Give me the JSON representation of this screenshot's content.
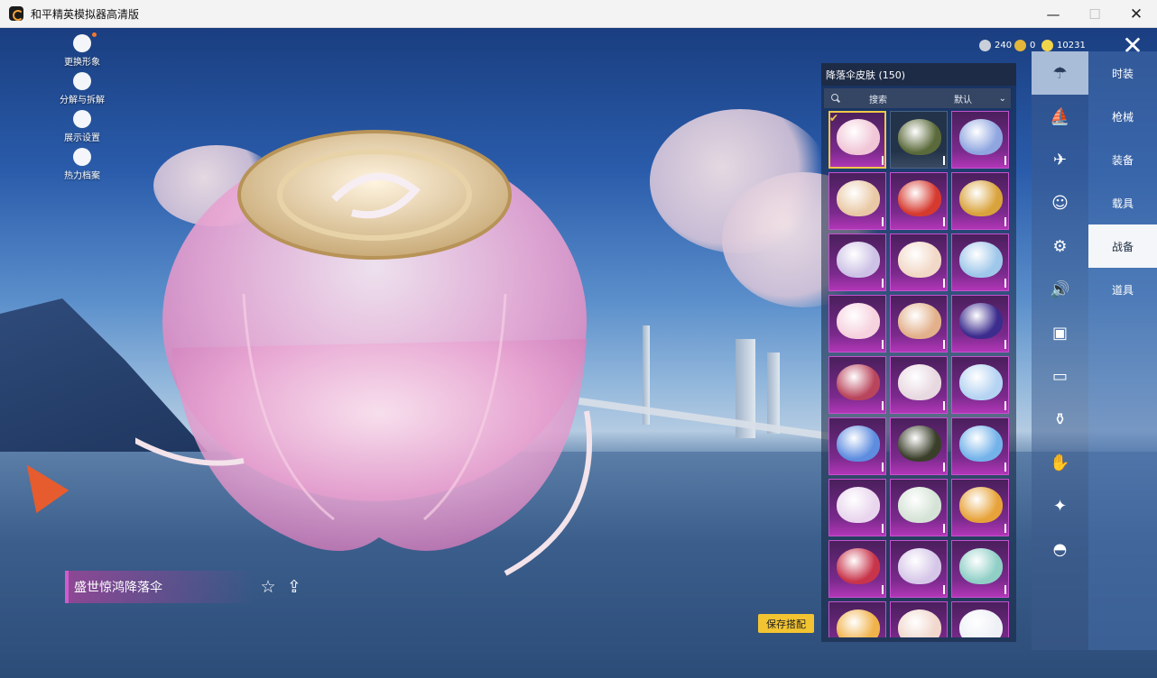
{
  "window": {
    "title": "和平精英模拟器高清版",
    "minimize": "—",
    "maximize": "☐",
    "close": "✕"
  },
  "left_menu": [
    {
      "label": "更换形象",
      "icon": "avatar-icon"
    },
    {
      "label": "分解与拆解",
      "icon": "puzzle-icon"
    },
    {
      "label": "展示设置",
      "icon": "eye-icon"
    },
    {
      "label": "热力档案",
      "icon": "flame-icon"
    }
  ],
  "currency": [
    {
      "value": "240",
      "icon": "coin-icon",
      "color": "#c9d0da"
    },
    {
      "value": "0",
      "icon": "badge-icon",
      "color": "#e3b53a"
    },
    {
      "value": "10231",
      "icon": "uc-icon",
      "color": "#f0d44a"
    }
  ],
  "close_symbol": "✕",
  "item": {
    "name": "盛世惊鸿降落伞",
    "favorite_symbol": "☆",
    "share_symbol": "⇪"
  },
  "save_button": "保存搭配",
  "panel": {
    "title": "降落伞皮肤 (150)",
    "search_placeholder": "搜索",
    "sort_value": "默认",
    "sort_chevron": "⌄"
  },
  "tiles": [
    {
      "variant": "purple",
      "color": "#f1c6d6",
      "selected": true
    },
    {
      "variant": "dark",
      "color": "#5b6a3a"
    },
    {
      "variant": "purple",
      "color": "#8fa6e0"
    },
    {
      "variant": "purple",
      "color": "#e9c9a5"
    },
    {
      "variant": "purple",
      "color": "#d63a2f"
    },
    {
      "variant": "purple",
      "color": "#d9a33c"
    },
    {
      "variant": "purple",
      "color": "#cdc2e6"
    },
    {
      "variant": "purple",
      "color": "#f2d8c6"
    },
    {
      "variant": "purple",
      "color": "#9ec7ea"
    },
    {
      "variant": "purple",
      "color": "#f6d1de"
    },
    {
      "variant": "purple",
      "color": "#e2b08a"
    },
    {
      "variant": "purple",
      "color": "#3b2c8e"
    },
    {
      "variant": "purple",
      "color": "#b9455c"
    },
    {
      "variant": "purple",
      "color": "#e8d8e0"
    },
    {
      "variant": "purple",
      "color": "#b5d3f2"
    },
    {
      "variant": "purple",
      "color": "#5e8de0"
    },
    {
      "variant": "purple",
      "color": "#3a3f2a"
    },
    {
      "variant": "purple",
      "color": "#74b3ea"
    },
    {
      "variant": "purple",
      "color": "#e9d6ee"
    },
    {
      "variant": "purple",
      "color": "#d5e3d6"
    },
    {
      "variant": "purple",
      "color": "#e7a33a"
    },
    {
      "variant": "purple",
      "color": "#c8344a"
    },
    {
      "variant": "purple",
      "color": "#d6c7e8"
    },
    {
      "variant": "purple",
      "color": "#8fcfc6"
    },
    {
      "variant": "purple",
      "color": "#f0b24a"
    },
    {
      "variant": "purple",
      "color": "#f1d7cc"
    },
    {
      "variant": "purple",
      "color": "#eef0f6"
    }
  ],
  "rail": [
    {
      "icon": "parachute-icon",
      "active": true
    },
    {
      "icon": "boat-icon"
    },
    {
      "icon": "plane-icon"
    },
    {
      "icon": "emote-icon"
    },
    {
      "icon": "robot-icon"
    },
    {
      "icon": "speaker-icon"
    },
    {
      "icon": "card-icon"
    },
    {
      "icon": "picture-icon"
    },
    {
      "icon": "spray-icon"
    },
    {
      "icon": "hand-icon"
    },
    {
      "icon": "sparkle-icon"
    },
    {
      "icon": "hat-icon"
    }
  ],
  "rail_glyphs": [
    "☂",
    "⛵",
    "✈",
    "☺",
    "⚙",
    "🔊",
    "▣",
    "▭",
    "⚱",
    "✋",
    "✦",
    "◓"
  ],
  "categories": [
    {
      "label": "时装"
    },
    {
      "label": "枪械"
    },
    {
      "label": "装备"
    },
    {
      "label": "载具"
    },
    {
      "label": "战备",
      "active": true
    },
    {
      "label": "道具"
    }
  ]
}
